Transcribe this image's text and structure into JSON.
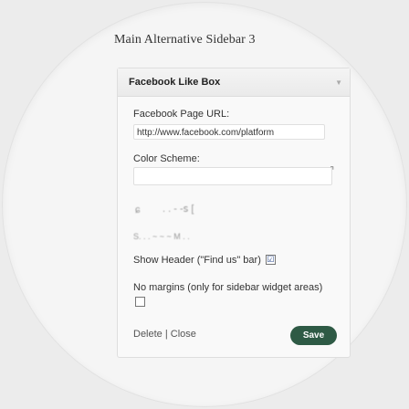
{
  "sidebar": {
    "title": "Main Alternative Sidebar 3"
  },
  "widget": {
    "title": "Facebook Like Box",
    "toggle_icon": "triangle-down-icon",
    "page_url_label": "Facebook Page URL:",
    "page_url_value": "http://www.facebook.com/platform",
    "color_scheme_label": "Color Scheme:",
    "show_header_label": "Show Header (\"Find us\" bar)",
    "show_header_checked": "☑",
    "no_margins_label": "No margins (only for sidebar widget areas)",
    "no_margins_checked": "",
    "delete_label": "Delete",
    "separator": "|",
    "close_label": "Close",
    "save_label": "Save"
  },
  "colors": {
    "save_button": "#2e5a45",
    "widget_bg": "#f9f9f9"
  }
}
